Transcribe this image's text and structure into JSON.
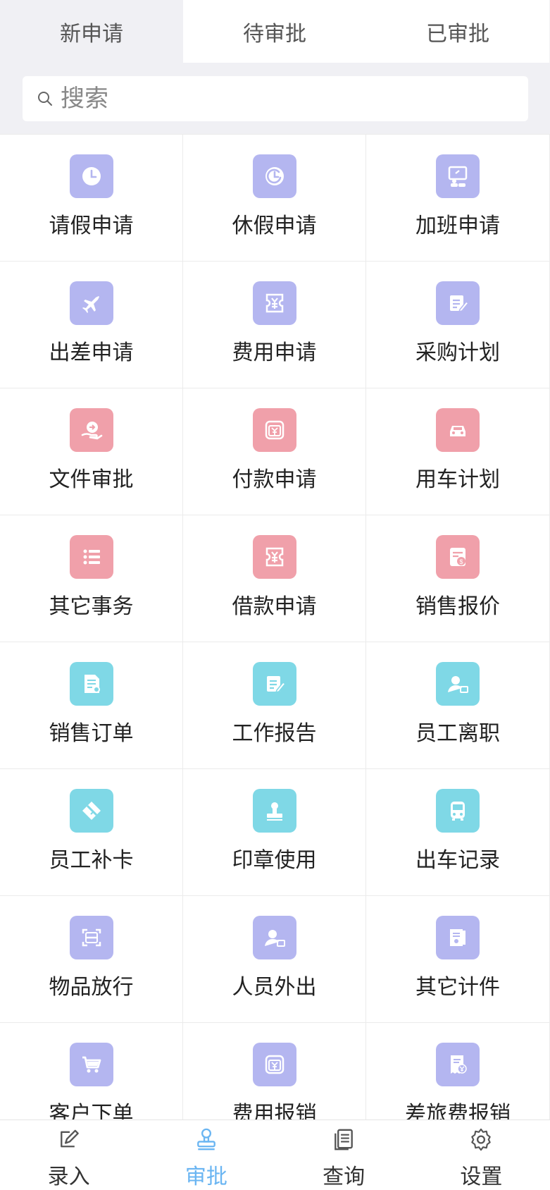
{
  "tabs": [
    {
      "label": "新申请",
      "active": true
    },
    {
      "label": "待审批",
      "active": false
    },
    {
      "label": "已审批",
      "active": false
    }
  ],
  "search": {
    "placeholder": "搜索"
  },
  "colors": {
    "purple": "#b4b6f0",
    "pink": "#f0a0aa",
    "cyan": "#7fd8e6",
    "active_nav": "#6ab5f2"
  },
  "grid_items": [
    {
      "label": "请假申请",
      "icon": "clock-icon",
      "color": "purple"
    },
    {
      "label": "休假申请",
      "icon": "clock-arrow-icon",
      "color": "purple"
    },
    {
      "label": "加班申请",
      "icon": "presentation-icon",
      "color": "purple"
    },
    {
      "label": "出差申请",
      "icon": "airplane-icon",
      "color": "purple"
    },
    {
      "label": "费用申请",
      "icon": "ticket-yen-icon",
      "color": "purple"
    },
    {
      "label": "采购计划",
      "icon": "note-edit-icon",
      "color": "purple"
    },
    {
      "label": "文件审批",
      "icon": "hand-file-icon",
      "color": "pink"
    },
    {
      "label": "付款申请",
      "icon": "yen-box-icon",
      "color": "pink"
    },
    {
      "label": "用车计划",
      "icon": "car-icon",
      "color": "pink"
    },
    {
      "label": "其它事务",
      "icon": "list-icon",
      "color": "pink"
    },
    {
      "label": "借款申请",
      "icon": "ticket-yen-icon",
      "color": "pink"
    },
    {
      "label": "销售报价",
      "icon": "invoice-dollar-icon",
      "color": "pink"
    },
    {
      "label": "销售订单",
      "icon": "document-icon",
      "color": "cyan"
    },
    {
      "label": "工作报告",
      "icon": "note-edit-icon",
      "color": "cyan"
    },
    {
      "label": "员工离职",
      "icon": "user-card-icon",
      "color": "cyan"
    },
    {
      "label": "员工补卡",
      "icon": "card-swipe-icon",
      "color": "cyan"
    },
    {
      "label": "印章使用",
      "icon": "stamp-icon",
      "color": "cyan"
    },
    {
      "label": "出车记录",
      "icon": "bus-icon",
      "color": "cyan"
    },
    {
      "label": "物品放行",
      "icon": "scan-icon",
      "color": "purple"
    },
    {
      "label": "人员外出",
      "icon": "user-card-icon",
      "color": "purple"
    },
    {
      "label": "其它计件",
      "icon": "book-icon",
      "color": "purple"
    },
    {
      "label": "客户下单",
      "icon": "cart-icon",
      "color": "purple"
    },
    {
      "label": "费用报销",
      "icon": "yen-box-icon",
      "color": "purple"
    },
    {
      "label": "差旅费报销",
      "icon": "receipt-yen-icon",
      "color": "purple"
    }
  ],
  "bottom_nav": [
    {
      "label": "录入",
      "icon": "edit-icon",
      "active": false
    },
    {
      "label": "审批",
      "icon": "stamp-outline-icon",
      "active": true
    },
    {
      "label": "查询",
      "icon": "documents-icon",
      "active": false
    },
    {
      "label": "设置",
      "icon": "gear-icon",
      "active": false
    }
  ]
}
